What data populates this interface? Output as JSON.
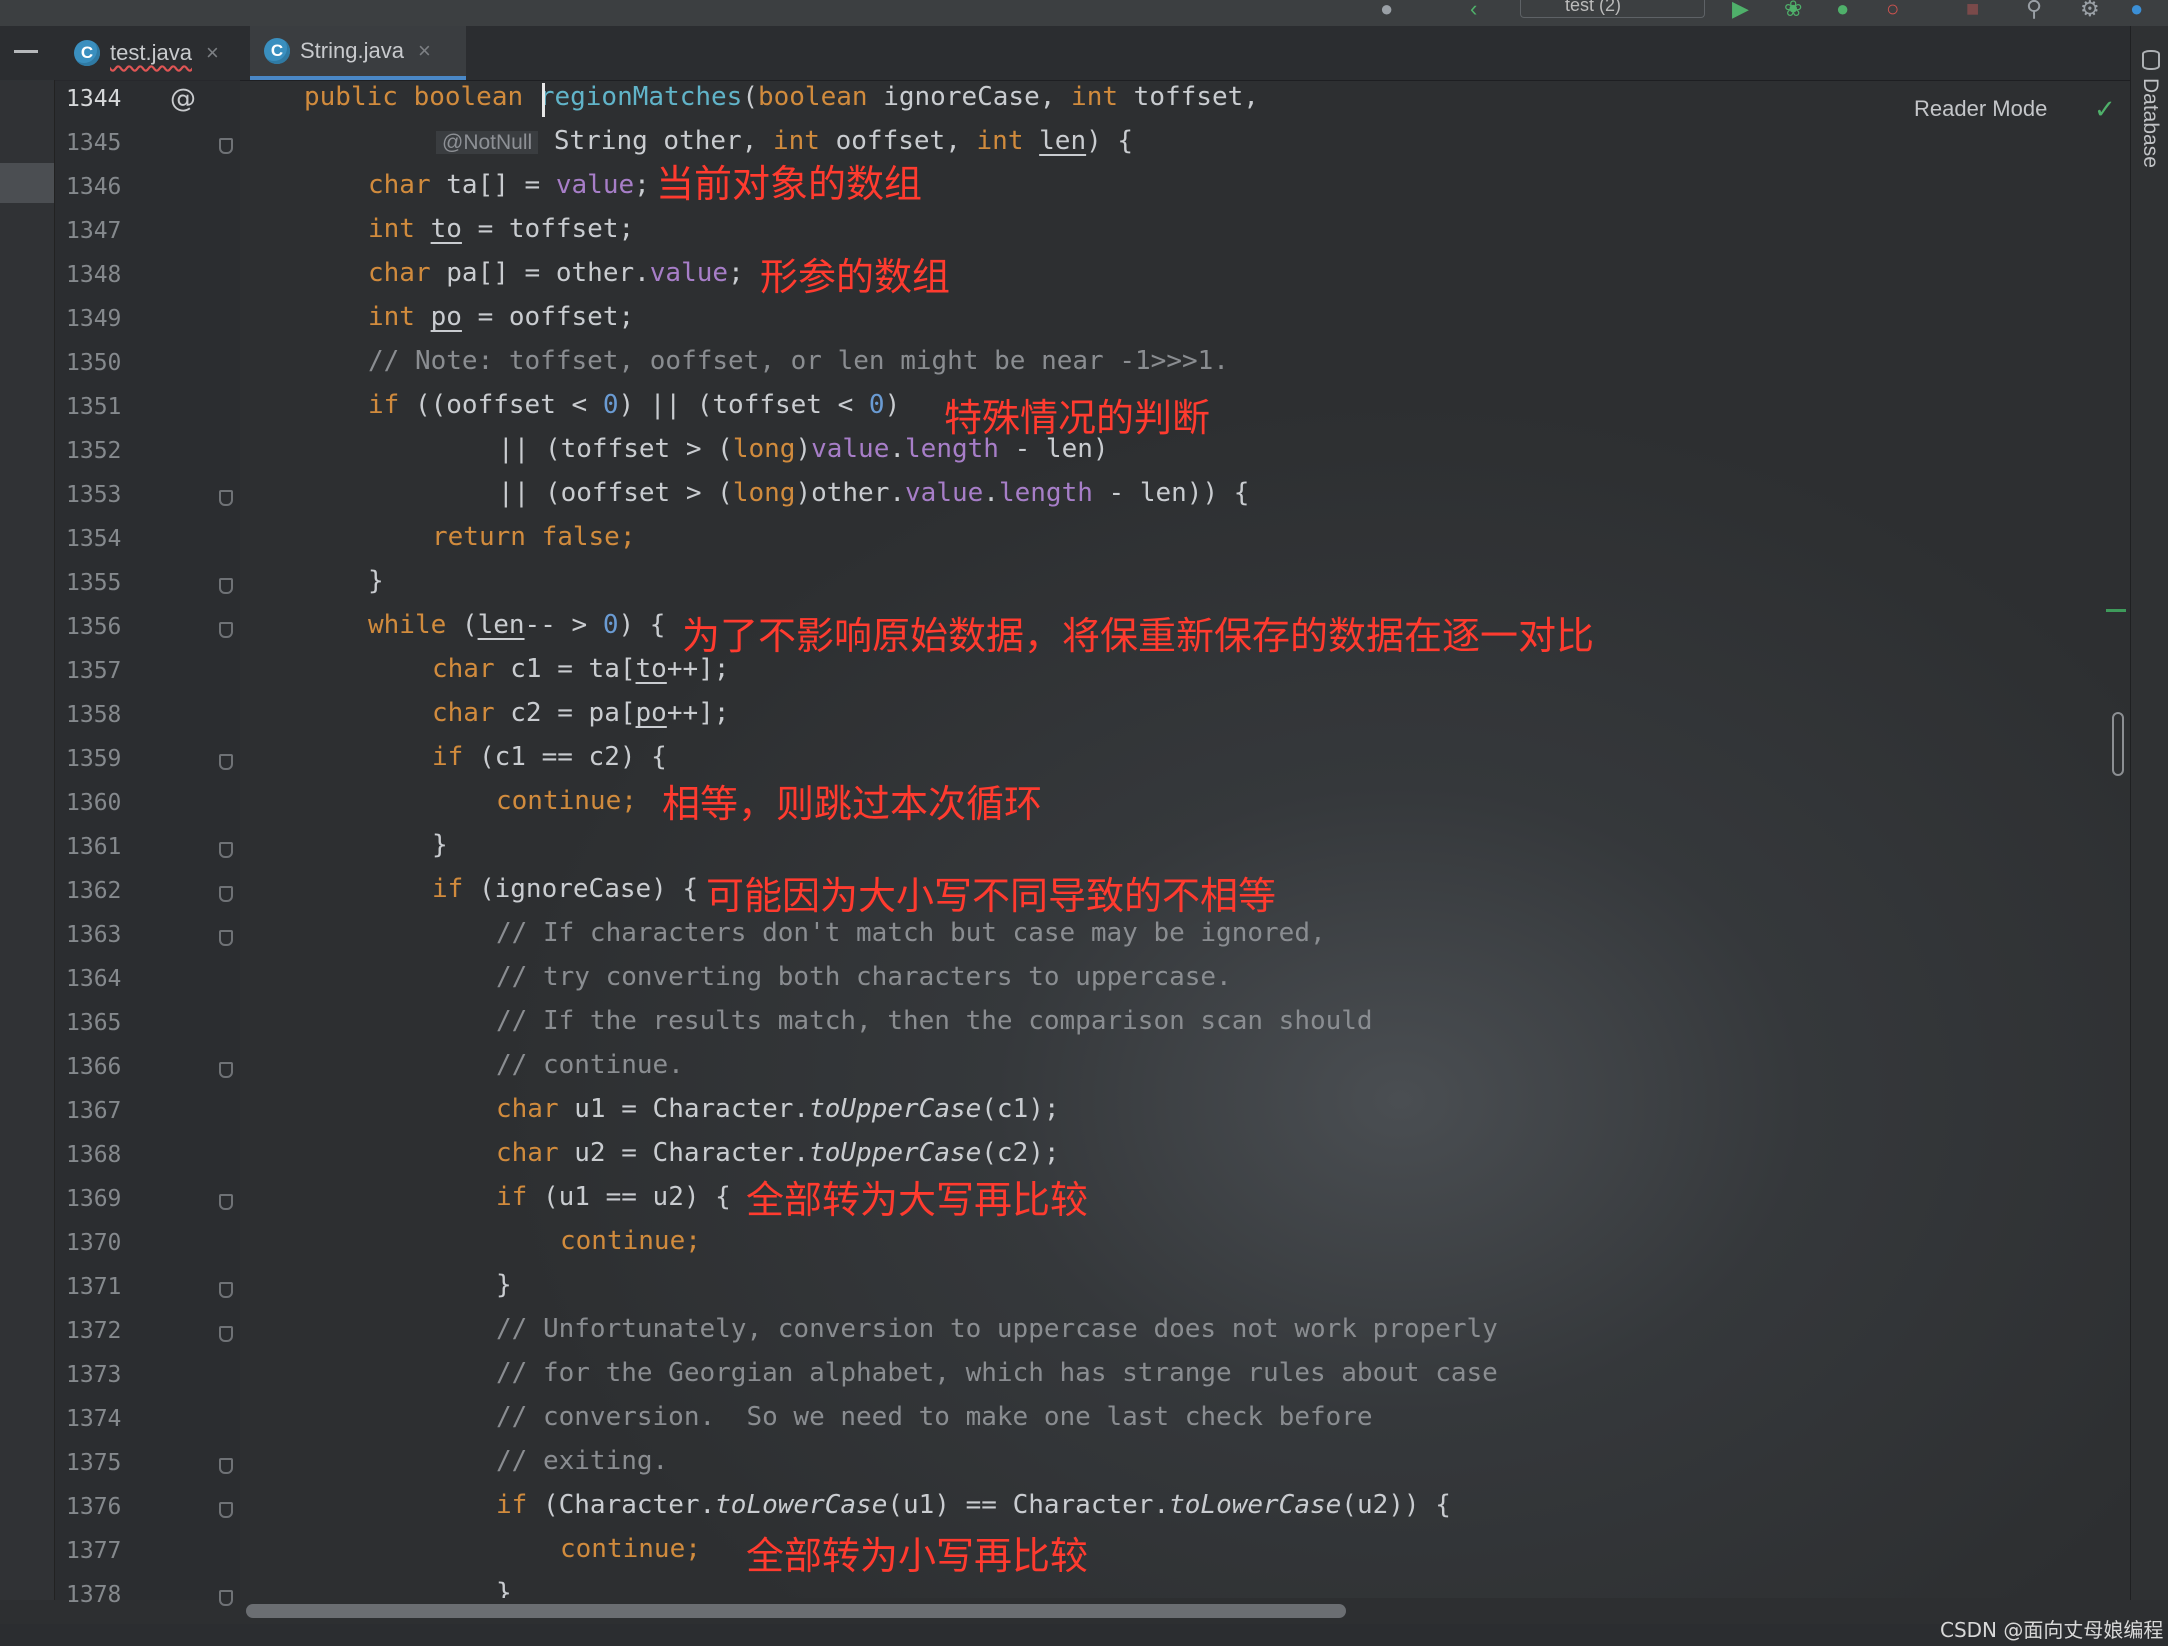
{
  "tabs": [
    {
      "label": "test.java",
      "icon": "java-class-icon",
      "close": "×"
    },
    {
      "label": "String.java",
      "icon": "java-class-icon",
      "close": "×"
    }
  ],
  "toolbar": {
    "run_config": "test (2)"
  },
  "editor": {
    "reader_mode": "Reader Mode",
    "gutter_annotation": "@",
    "not_null": "@NotNull",
    "line_numbers": [
      "1344",
      "1345",
      "1346",
      "1347",
      "1348",
      "1349",
      "1350",
      "1351",
      "1352",
      "1353",
      "1354",
      "1355",
      "1356",
      "1357",
      "1358",
      "1359",
      "1360",
      "1361",
      "1362",
      "1363",
      "1364",
      "1365",
      "1366",
      "1367",
      "1368",
      "1369",
      "1370",
      "1371",
      "1372",
      "1373",
      "1374",
      "1375",
      "1376",
      "1377",
      "1378"
    ],
    "comments": {
      "c1350": "// Note: toffset, ooffset, or len might be near -1>>>1.",
      "c1363": "// If characters don't match but case may be ignored,",
      "c1364": "// try converting both characters to uppercase.",
      "c1365": "// If the results match, then the comparison scan should",
      "c1366": "// continue.",
      "c1372": "// Unfortunately, conversion to uppercase does not work properly",
      "c1373": "// for the Georgian alphabet, which has strange rules about case",
      "c1374": "// conversion.  So we need to make one last check before",
      "c1375": "// exiting."
    }
  },
  "annotations": {
    "a1346": "当前对象的数组",
    "a1348": "形参的数组",
    "a1351": "特殊情况的判断",
    "a1356": "为了不影响原始数据，将保重新保存的数据在逐一对比",
    "a1360": "相等，则跳过本次循环",
    "a1362": "可能因为大小写不同导致的不相等",
    "a1369": "全部转为大写再比较",
    "a1377": "全部转为小写再比较"
  },
  "side_panel": {
    "database": "Database"
  },
  "watermark": "CSDN @面向丈母娘编程",
  "colors": {
    "keyword": "#d18b3d",
    "field": "#a77ec8",
    "number": "#6a9bd3",
    "method": "#61b4c9",
    "comment": "#8a8d91",
    "annotation_red": "#ff3b2f",
    "tab_accent": "#4a88c7"
  }
}
